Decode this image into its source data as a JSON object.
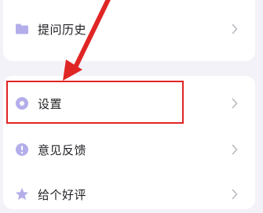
{
  "menu": {
    "history_label": "提问历史",
    "settings_label": "设置",
    "feedback_label": "意见反馈",
    "rate_label": "给个好评"
  },
  "colors": {
    "icon_purple": "#b3aeea",
    "highlight_red": "#e02525",
    "chevron": "#b9b9c0",
    "background": "#f3f2f8"
  },
  "icons": {
    "history": "folder-icon",
    "settings": "gear-icon",
    "feedback": "info-icon",
    "rate": "star-icon",
    "chevron": "chevron-right-icon"
  }
}
